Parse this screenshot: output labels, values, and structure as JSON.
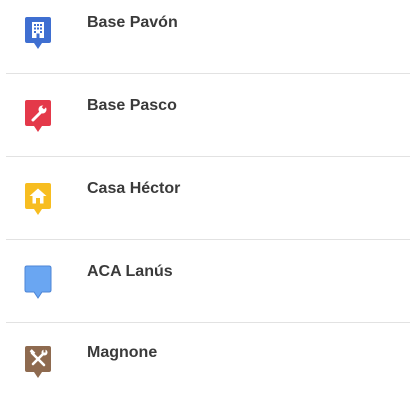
{
  "places": [
    {
      "label": "Base Pavón",
      "icon": "building-icon",
      "color": "#3f6fd1"
    },
    {
      "label": "Base Pasco",
      "icon": "wrench-icon",
      "color": "#e4394a"
    },
    {
      "label": "Casa Héctor",
      "icon": "home-icon",
      "color": "#f7bd20"
    },
    {
      "label": "ACA Lanús",
      "icon": "blank-marker-icon",
      "color": "#6aa6f2"
    },
    {
      "label": "Magnone",
      "icon": "tools-icon",
      "color": "#8e6a4f"
    }
  ]
}
